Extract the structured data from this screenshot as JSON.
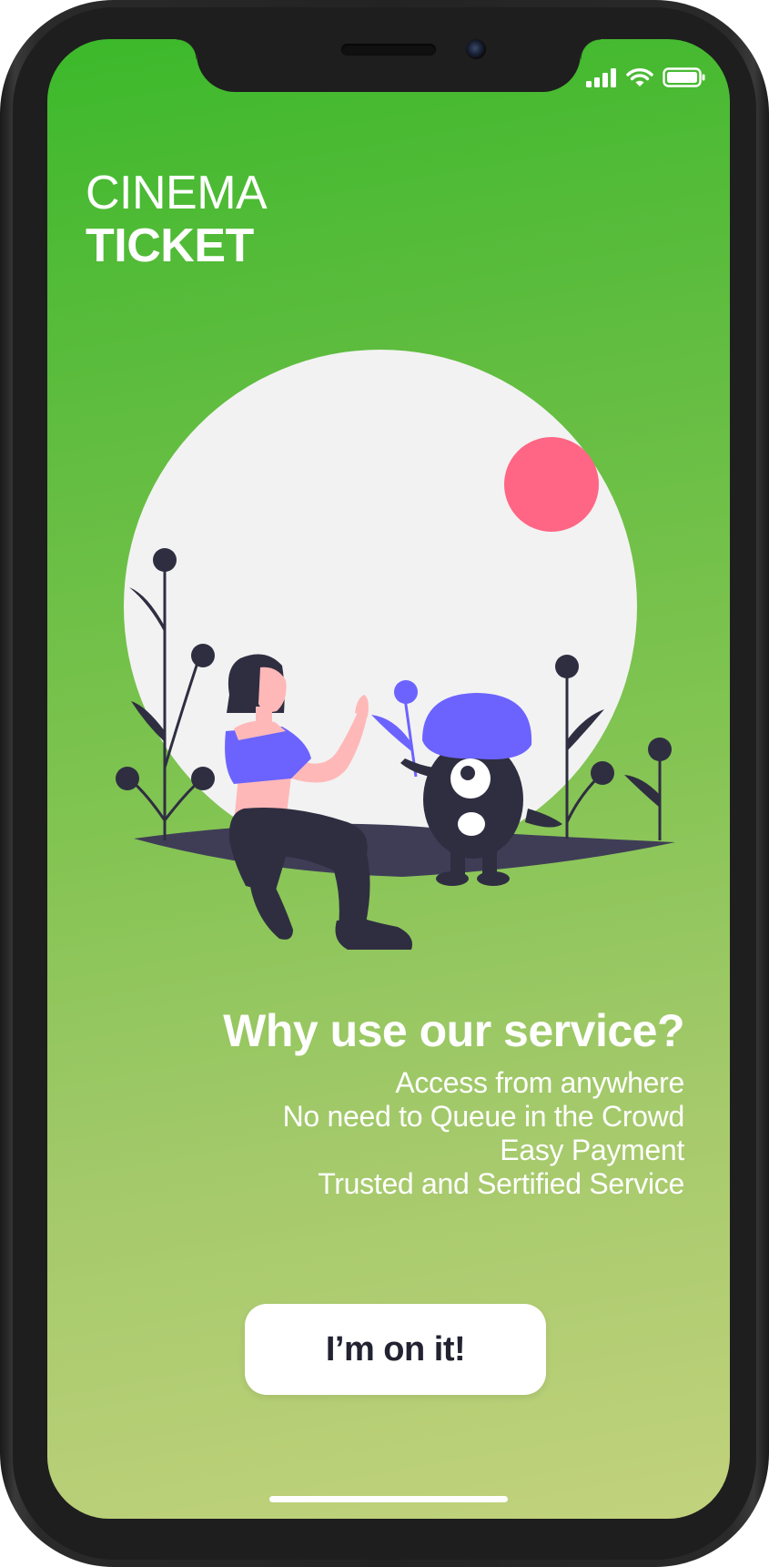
{
  "app": {
    "title_line1": "CINEMA",
    "title_line2": "TICKET"
  },
  "status_bar": {
    "icons": [
      "cellular-signal-icon",
      "wifi-icon",
      "battery-icon"
    ]
  },
  "info": {
    "heading": "Why use our service?",
    "items": [
      "Access from anywhere",
      "No need to Queue in the Crowd",
      "Easy Payment",
      "Trusted and Sertified Service"
    ]
  },
  "cta": {
    "label": "I’m on it!"
  },
  "colors": {
    "gradient_top": "#3cb92b",
    "gradient_bottom": "#c2d27d",
    "accent_purple": "#6c63ff",
    "accent_pink": "#ff6584",
    "dark": "#2f2e41",
    "circle": "#f2f2f2"
  }
}
